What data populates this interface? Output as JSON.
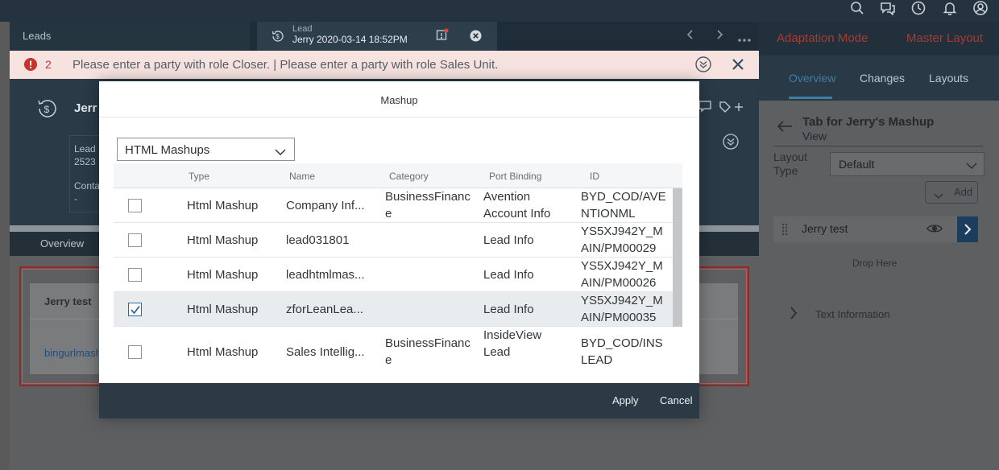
{
  "tabs": {
    "leads_tab": "Leads",
    "lead_tab_type": "Lead",
    "lead_tab_title": "Jerry 2020-03-14 18:52PM"
  },
  "error_strip": {
    "count": "2",
    "message": "Please enter a party with role Closer. | Please enter a party with role Sales Unit."
  },
  "object_header": {
    "title": "Jerr",
    "lead_label": "Lead",
    "lead_id": "2523",
    "contact_label": "Conta",
    "contact_value": "-",
    "tab_overview": "Overview"
  },
  "card": {
    "title": "Jerry test",
    "link": "bingurlmash"
  },
  "right_panel": {
    "adaptation_mode": "Adaptation Mode",
    "master_layout": "Master Layout",
    "tabs": [
      "Overview",
      "Changes",
      "Layouts"
    ],
    "view_title": "Tab for Jerry's Mashup",
    "view_subtitle": "View",
    "layout_type_label": "Layout Type",
    "layout_type_value": "Default",
    "add_label": "Add",
    "item_label": "Jerry test",
    "drop_here": "Drop Here",
    "text_information": "Text Information"
  },
  "dialog": {
    "title": "Mashup",
    "filter_value": "HTML Mashups",
    "columns": [
      "Type",
      "Name",
      "Category",
      "Port Binding",
      "ID"
    ],
    "rows": [
      {
        "checked": false,
        "type": "Html Mashup",
        "name": "Company Inf...",
        "category": "BusinessFinance",
        "port": "Avention Account Info",
        "id": "BYD_COD/AVENTIONML"
      },
      {
        "checked": false,
        "type": "Html Mashup",
        "name": "lead031801",
        "category": "",
        "port": "Lead Info",
        "id": "YS5XJ942Y_MAIN/PM00029"
      },
      {
        "checked": false,
        "type": "Html Mashup",
        "name": "leadhtmlmas...",
        "category": "",
        "port": "Lead Info",
        "id": "YS5XJ942Y_MAIN/PM00026"
      },
      {
        "checked": true,
        "type": "Html Mashup",
        "name": "zforLeanLea...",
        "category": "",
        "port": "Lead Info",
        "id": "YS5XJ942Y_MAIN/PM00035"
      },
      {
        "checked": false,
        "type": "Html Mashup",
        "name": "Sales Intellig...",
        "category": "BusinessFinance",
        "port": "InsideView Lead Information",
        "id": "BYD_COD/INSLEAD"
      }
    ],
    "apply": "Apply",
    "cancel": "Cancel"
  },
  "icons": [
    "search-icon",
    "feedback-icon",
    "history-icon",
    "bell-icon",
    "user-icon"
  ]
}
